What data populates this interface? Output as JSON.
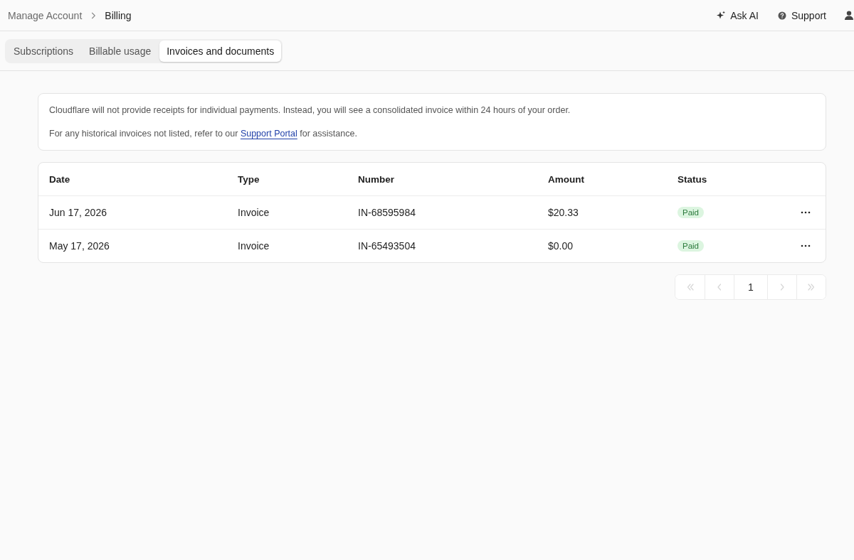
{
  "breadcrumb": [
    {
      "label": "Manage Account",
      "current": false
    },
    {
      "label": "Billing",
      "current": true
    }
  ],
  "header_actions": [
    {
      "kind": "ask_ai",
      "label": "Ask AI"
    },
    {
      "kind": "support",
      "label": "Support"
    }
  ],
  "tabs": [
    {
      "label": "Subscriptions",
      "selected": false
    },
    {
      "label": "Billable usage",
      "selected": false
    },
    {
      "label": "Invoices and documents",
      "selected": true
    }
  ],
  "notice": {
    "lines": [
      {
        "text": "Cloudflare will not provide receipts for individual payments. Instead, you will see a consolidated invoice within 24 hours of your order."
      },
      {
        "text": "For any historical invoices not listed, refer to our ",
        "link": "Support Portal",
        "after": " for assistance."
      }
    ]
  },
  "table": {
    "columns": [
      "Date",
      "Type",
      "Number",
      "Amount",
      "Status"
    ],
    "rows": [
      {
        "date": "Jun 17, 2026",
        "type": "Invoice",
        "number": "IN-68595984",
        "amount": "$20.33",
        "status": {
          "label": "Paid",
          "kind": "success"
        }
      },
      {
        "date": "May 17, 2026",
        "type": "Invoice",
        "number": "IN-65493504",
        "amount": "$0.00",
        "status": {
          "label": "Paid",
          "kind": "success"
        }
      }
    ]
  },
  "pagination": {
    "buttons": [
      {
        "kind": "first",
        "disabled": true
      },
      {
        "kind": "prev",
        "disabled": true
      },
      {
        "kind": "page",
        "label": "1",
        "disabled": false
      },
      {
        "kind": "next",
        "disabled": true
      },
      {
        "kind": "last",
        "disabled": true
      }
    ]
  }
}
